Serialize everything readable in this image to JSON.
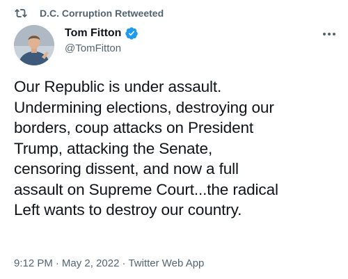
{
  "retweet": {
    "icon": "retweet-icon",
    "text": "D.C. Corruption Retweeted"
  },
  "author": {
    "name": "Tom Fitton",
    "handle": "@TomFitton",
    "verified_icon": "verified-badge-icon",
    "avatar_icon": "avatar"
  },
  "more_icon": "more-options-icon",
  "tweet": {
    "text": "Our Republic is under assault.\nUndermining elections, destroying our\nborders, coup attacks on President\nTrump, attacking the Senate,\ncensoring dissent, and now a full\nassault on Supreme Court...the radical\nLeft wants to destroy our country."
  },
  "meta": {
    "time": "9:12 PM",
    "separator": "·",
    "date": "May 2, 2022",
    "source": "Twitter Web App"
  },
  "colors": {
    "text_primary": "#0f1419",
    "text_secondary": "#536471",
    "verified_blue": "#1d9bf0",
    "background": "#ffffff"
  }
}
